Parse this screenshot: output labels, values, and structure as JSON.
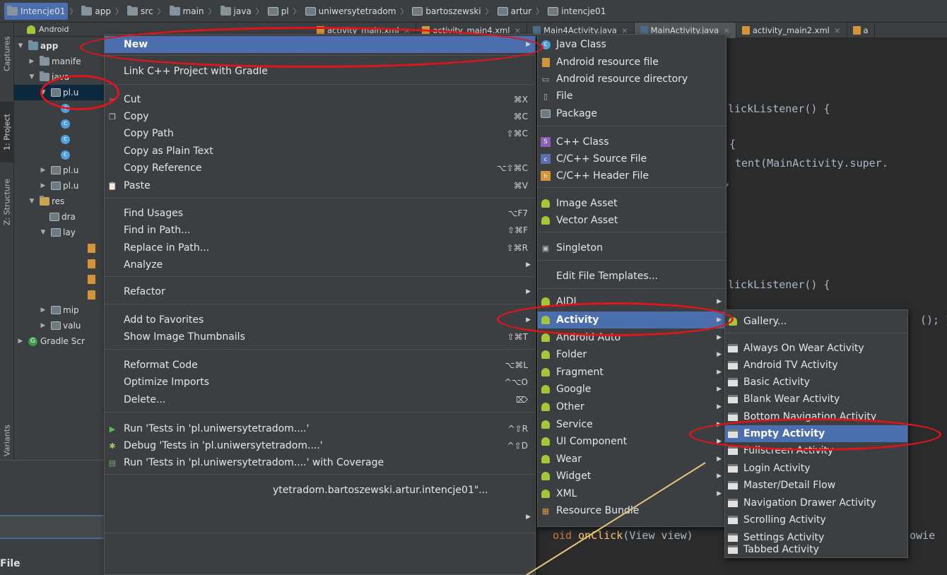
{
  "breadcrumb": [
    "Intencje01",
    "app",
    "src",
    "main",
    "java",
    "pl",
    "uniwersytetradom",
    "bartoszewski",
    "artur",
    "intencje01"
  ],
  "tool_window_tabs": {
    "captures": "Captures",
    "project": "1: Project",
    "structure": "Z: Structure",
    "variants": "Variants"
  },
  "project_panel": {
    "view_selector": "Android",
    "tree": [
      {
        "label": "app"
      },
      {
        "label": "manife"
      },
      {
        "label": "java"
      },
      {
        "label": "pl.u"
      },
      {
        "label": "pl.u"
      },
      {
        "label": "pl.u"
      },
      {
        "label": "res"
      },
      {
        "label": "dra"
      },
      {
        "label": "lay"
      },
      {
        "label": "mip"
      },
      {
        "label": "valu"
      },
      {
        "label": "Gradle Scr"
      }
    ]
  },
  "editor_tabs": [
    "activity_main.xml",
    "activity_main4.xml",
    "Main4Activity.java",
    "MainActivity.java",
    "activity_main2.xml",
    "a"
  ],
  "code": {
    "l1": "lickListener() {",
    "l2": "{",
    "l3": "tent(MainActivity.super.",
    "l4": ",",
    "l5": "lickListener() {",
    "l6": "(); }",
    "l7_kw": "oid",
    "l7_fn": "onClick",
    "l7_rest": "(View view)",
    "l7_tail": "owie"
  },
  "context_menu": {
    "items": [
      {
        "label": "New",
        "submenu": true
      },
      {
        "label": "Link C++ Project with Gradle"
      },
      {
        "label": "Cut",
        "shortcut": "⌘X"
      },
      {
        "label": "Copy",
        "shortcut": "⌘C"
      },
      {
        "label": "Copy Path",
        "shortcut": "⇧⌘C"
      },
      {
        "label": "Copy as Plain Text"
      },
      {
        "label": "Copy Reference",
        "shortcut": "⌥⇧⌘C"
      },
      {
        "label": "Paste",
        "shortcut": "⌘V"
      },
      {
        "label": "Find Usages",
        "shortcut": "⌥F7"
      },
      {
        "label": "Find in Path...",
        "shortcut": "⇧⌘F"
      },
      {
        "label": "Replace in Path...",
        "shortcut": "⇧⌘R"
      },
      {
        "label": "Analyze",
        "submenu": true
      },
      {
        "label": "Refactor",
        "submenu": true
      },
      {
        "label": "Add to Favorites",
        "submenu": true
      },
      {
        "label": "Show Image Thumbnails",
        "shortcut": "⇧⌘T"
      },
      {
        "label": "Reformat Code",
        "shortcut": "⌥⌘L"
      },
      {
        "label": "Optimize Imports",
        "shortcut": "^⌥O"
      },
      {
        "label": "Delete...",
        "shortcut": "⌦"
      },
      {
        "label": "Run 'Tests in 'pl.uniwersytetradom....'",
        "shortcut": "^⇧R"
      },
      {
        "label": "Debug 'Tests in 'pl.uniwersytetradom....'",
        "shortcut": "^⇧D"
      },
      {
        "label": "Run 'Tests in 'pl.uniwersytetradom....' with Coverage"
      },
      {
        "label": "ytetradom.bartoszewski.artur.intencje01\"..."
      }
    ]
  },
  "new_submenu": {
    "items": [
      {
        "label": "Java Class"
      },
      {
        "label": "Android resource file"
      },
      {
        "label": "Android resource directory"
      },
      {
        "label": "File"
      },
      {
        "label": "Package"
      },
      {
        "label": "C++ Class"
      },
      {
        "label": "C/C++ Source File"
      },
      {
        "label": "C/C++ Header File"
      },
      {
        "label": "Image Asset"
      },
      {
        "label": "Vector Asset"
      },
      {
        "label": "Singleton"
      },
      {
        "label": "Edit File Templates..."
      },
      {
        "label": "AIDL"
      },
      {
        "label": "Activity"
      },
      {
        "label": "Android Auto"
      },
      {
        "label": "Folder"
      },
      {
        "label": "Fragment"
      },
      {
        "label": "Google"
      },
      {
        "label": "Other"
      },
      {
        "label": "Service"
      },
      {
        "label": "UI Component"
      },
      {
        "label": "Wear"
      },
      {
        "label": "Widget"
      },
      {
        "label": "XML"
      },
      {
        "label": "Resource Bundle"
      }
    ]
  },
  "activity_submenu": {
    "items": [
      {
        "label": "Gallery..."
      },
      {
        "label": "Always On Wear Activity"
      },
      {
        "label": "Android TV Activity"
      },
      {
        "label": "Basic Activity"
      },
      {
        "label": "Blank Wear Activity"
      },
      {
        "label": "Bottom Navigation Activity"
      },
      {
        "label": "Empty Activity"
      },
      {
        "label": "Fullscreen Activity"
      },
      {
        "label": "Login Activity"
      },
      {
        "label": "Master/Detail Flow"
      },
      {
        "label": "Navigation Drawer Activity"
      },
      {
        "label": "Scrolling Activity"
      },
      {
        "label": "Settings Activity"
      },
      {
        "label": "Tabbed Activity"
      }
    ]
  },
  "dialog_fragment": {
    "section_label": "File"
  },
  "colors": {
    "highlight": "#4b6eaf",
    "annotation": "#e0141b",
    "callout_line": "#e8c77a",
    "android_green": "#a4c639"
  }
}
